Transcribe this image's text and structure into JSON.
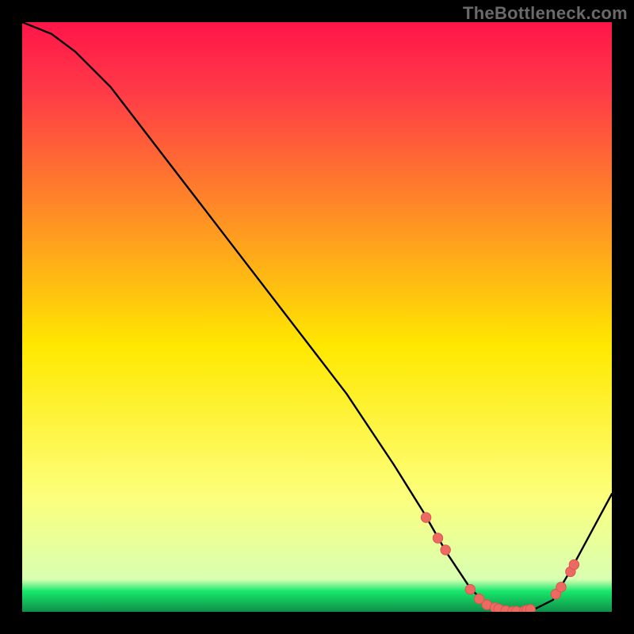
{
  "watermark": "TheBottleneck.com",
  "colors": {
    "curve": "#000000",
    "marker_fill": "#ed6a63",
    "marker_stroke": "#d9554f",
    "top_grad": "#ff1549",
    "mid_grad": "#ffe800",
    "green_grad": "#17e86c",
    "bottom_grad": "#0e8f48"
  },
  "chart_data": {
    "type": "line",
    "title": "",
    "xlabel": "",
    "ylabel": "",
    "xlim": [
      0,
      100
    ],
    "ylim": [
      0,
      100
    ],
    "series": [
      {
        "name": "bottleneck-curve",
        "x": [
          0,
          5,
          9,
          15,
          25,
          35,
          45,
          55,
          63,
          68,
          72,
          76,
          79,
          82,
          86,
          90,
          93,
          100
        ],
        "y": [
          100,
          98,
          95,
          89,
          76,
          63,
          50,
          37,
          25,
          17,
          10,
          4,
          1,
          0,
          0,
          2,
          7,
          20
        ]
      }
    ],
    "markers": {
      "name": "highlight-points",
      "x": [
        68.5,
        70.5,
        71.8,
        76.0,
        77.5,
        78.8,
        80.2,
        80.8,
        82.0,
        83.2,
        83.8,
        85.2,
        85.6,
        86.2,
        90.5,
        91.4,
        93.0,
        93.6
      ],
      "y": [
        16.0,
        12.5,
        10.5,
        3.8,
        2.2,
        1.2,
        0.7,
        0.5,
        0.2,
        0.1,
        0.1,
        0.2,
        0.3,
        0.4,
        3.0,
        4.2,
        6.8,
        8.0
      ]
    }
  }
}
